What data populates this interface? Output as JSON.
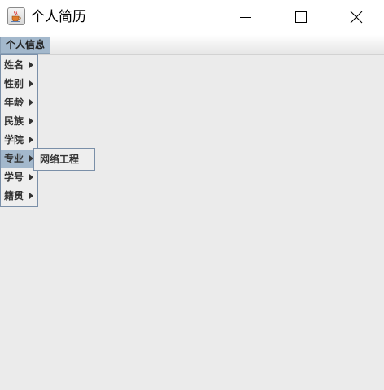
{
  "window": {
    "title": "个人简历",
    "icon": "java-cup-icon",
    "controls": {
      "minimize": "minimize-icon",
      "maximize": "maximize-icon",
      "close": "close-icon"
    }
  },
  "menubar": {
    "menus": [
      {
        "label": "个人信息",
        "open": true
      }
    ]
  },
  "popup": {
    "items": [
      {
        "label": "姓名",
        "has_submenu": true
      },
      {
        "label": "性别",
        "has_submenu": true
      },
      {
        "label": "年龄",
        "has_submenu": true
      },
      {
        "label": "民族",
        "has_submenu": true
      },
      {
        "label": "学院",
        "has_submenu": true
      },
      {
        "label": "专业",
        "has_submenu": true,
        "selected": true
      },
      {
        "label": "学号",
        "has_submenu": true
      },
      {
        "label": "籍贯",
        "has_submenu": true
      }
    ]
  },
  "submenu": {
    "items": [
      {
        "label": "网络工程"
      }
    ]
  },
  "colors": {
    "highlight": "#a3b8cc",
    "content_bg": "#ebebeb",
    "menu_border": "#7a8fa8"
  }
}
